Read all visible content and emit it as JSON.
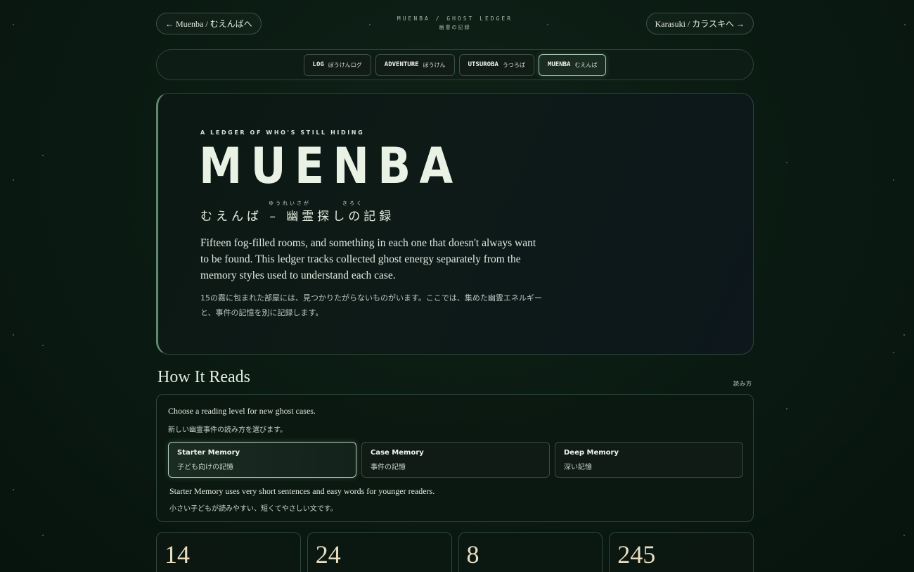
{
  "nav": {
    "back_link": "← Muenba / むえんばへ",
    "forward_link": "Karasuki / カラスキへ →",
    "brand_title": "MUENBA / GHOST LEDGER",
    "brand_subtitle": "幽霊の記録"
  },
  "tabs": [
    {
      "en": "LOG",
      "jp": "ぼうけんログ"
    },
    {
      "en": "ADVENTURE",
      "jp": "ぼうけん"
    },
    {
      "en": "UTSUROBA",
      "jp": "うつろば"
    },
    {
      "en": "MUENBA",
      "jp": "むえんば"
    }
  ],
  "hero": {
    "eyebrow": "A LEDGER OF WHO'S STILL HIDING",
    "title": "MUENBA",
    "jp_title": "むえんば – 幽霊探しの記録",
    "ruby_1": "ゆうれいさが",
    "ruby_2": "きろく",
    "description": "Fifteen fog-filled rooms, and something in each one that doesn't always want to be found. This ledger tracks collected ghost energy separately from the memory styles used to understand each case.",
    "description_jp": "15の霧に包まれた部屋には、見つかりたがらないものがいます。ここでは、集めた幽霊エネルギーと、事件の記憶を別に記録します。"
  },
  "reads": {
    "title": "How It Reads",
    "title_jp": "読み方",
    "intro": "Choose a reading level for new ghost cases.",
    "intro_jp": "新しい幽霊事件の読み方を選びます。",
    "levels": [
      {
        "name": "Starter Memory",
        "jp": "子ども向けの記憶"
      },
      {
        "name": "Case Memory",
        "jp": "事件の記憶"
      },
      {
        "name": "Deep Memory",
        "jp": "深い記憶"
      }
    ],
    "selected_desc": "Starter Memory uses very short sentences and easy words for younger readers.",
    "selected_desc_jp": "小さい子どもが読みやすい、短くてやさしい文です。"
  },
  "stats": [
    {
      "value": "14"
    },
    {
      "value": "24"
    },
    {
      "value": "8"
    },
    {
      "value": "245"
    }
  ]
}
